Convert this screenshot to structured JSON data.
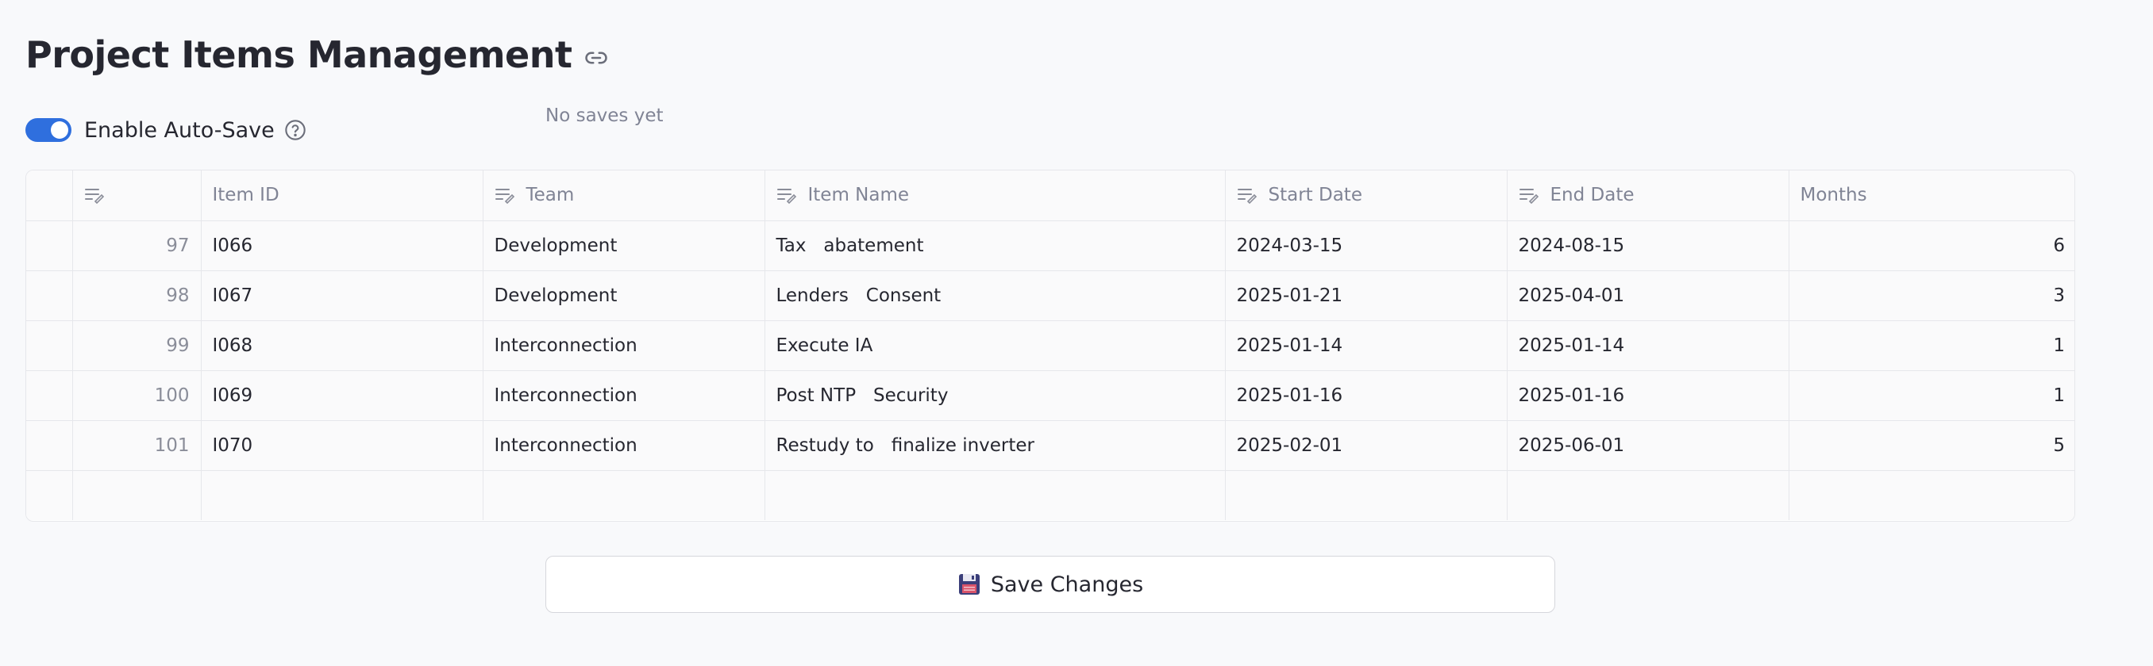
{
  "title": "Project Items Management",
  "autosave": {
    "label": "Enable Auto-Save",
    "enabled": true,
    "status": "No saves yet"
  },
  "table": {
    "columns": [
      "",
      "",
      "Item ID",
      "Team",
      "Item Name",
      "Start Date",
      "End Date",
      "Months"
    ],
    "editable_columns": [
      false,
      true,
      false,
      true,
      true,
      true,
      true,
      false
    ],
    "rows": [
      {
        "index": "97",
        "item_id": "I066",
        "team": "Development",
        "item_name": "Tax   abatement",
        "start": "2024-03-15",
        "end": "2024-08-15",
        "months": "6"
      },
      {
        "index": "98",
        "item_id": "I067",
        "team": "Development",
        "item_name": "Lenders   Consent",
        "start": "2025-01-21",
        "end": "2025-04-01",
        "months": "3"
      },
      {
        "index": "99",
        "item_id": "I068",
        "team": "Interconnection",
        "item_name": "Execute IA",
        "start": "2025-01-14",
        "end": "2025-01-14",
        "months": "1"
      },
      {
        "index": "100",
        "item_id": "I069",
        "team": "Interconnection",
        "item_name": "Post NTP   Security",
        "start": "2025-01-16",
        "end": "2025-01-16",
        "months": "1"
      },
      {
        "index": "101",
        "item_id": "I070",
        "team": "Interconnection",
        "item_name": "Restudy to   finalize inverter",
        "start": "2025-02-01",
        "end": "2025-06-01",
        "months": "5"
      }
    ]
  },
  "save_button": {
    "label": "Save Changes",
    "icon": "floppy-disk-icon"
  },
  "colors": {
    "accent": "#2f6fde",
    "background": "#f8f9fb",
    "text": "#262730",
    "muted": "#808495"
  }
}
